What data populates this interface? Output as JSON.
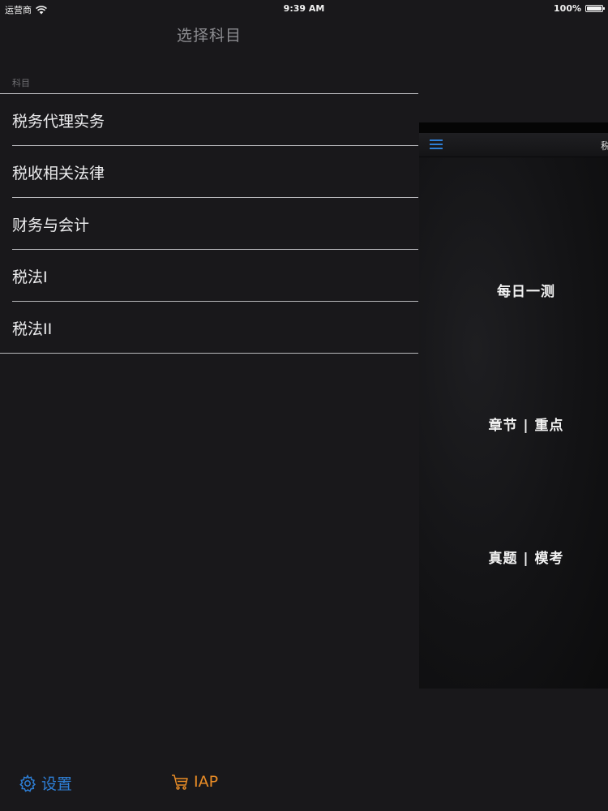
{
  "status_bar": {
    "carrier": "运营商",
    "time": "9:39 AM",
    "battery": "100%"
  },
  "master": {
    "title": "选择科目",
    "section_header": "科目",
    "subjects": [
      {
        "label": "税务代理实务"
      },
      {
        "label": "税收相关法律"
      },
      {
        "label": "财务与会计"
      },
      {
        "label": "税法I"
      },
      {
        "label": "税法II"
      }
    ]
  },
  "detail": {
    "nav_title": "税",
    "buttons": {
      "daily_test": "每日一测",
      "chapter_focus": "章节 | 重点",
      "exam_mock": "真题 | 模考"
    }
  },
  "toolbar": {
    "settings_label": "设置",
    "iap_label": "IAP"
  },
  "colors": {
    "background": "#19181b",
    "accent_blue": "#2e7fd6",
    "accent_orange": "#e98c26",
    "separator": "#b9b9bd"
  }
}
